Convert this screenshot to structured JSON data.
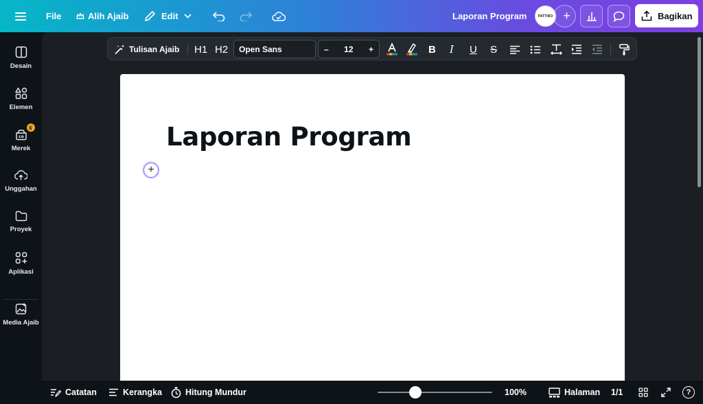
{
  "topbar": {
    "file_label": "File",
    "magic_switch_label": "Alih Ajaib",
    "edit_label": "Edit",
    "doc_title": "Laporan Program",
    "avatar_text": "PATTIRO",
    "share_label": "Bagikan"
  },
  "sidebar": {
    "items": [
      {
        "label": "Desain",
        "icon": "layout-icon"
      },
      {
        "label": "Elemen",
        "icon": "shapes-icon"
      },
      {
        "label": "Merek",
        "icon": "brand-icon"
      },
      {
        "label": "Unggahan",
        "icon": "cloud-upload-icon"
      },
      {
        "label": "Proyek",
        "icon": "folder-icon"
      },
      {
        "label": "Aplikasi",
        "icon": "apps-icon"
      },
      {
        "label": "Media Ajaib",
        "icon": "magic-media-icon"
      }
    ]
  },
  "format_toolbar": {
    "magic_write_label": "Tulisan Ajaib",
    "h1_label": "H1",
    "h2_label": "H2",
    "font_family": "Open Sans",
    "font_size": "12",
    "minus": "–",
    "plus": "+",
    "bold": "B",
    "italic": "I",
    "underline": "U",
    "strike": "S"
  },
  "page": {
    "heading": "Laporan Program"
  },
  "bottombar": {
    "notes_label": "Catatan",
    "outline_label": "Kerangka",
    "countdown_label": "Hitung Mundur",
    "zoom_value": "100%",
    "zoom_level": 0.33,
    "pages_label": "Halaman",
    "page_count": "1/1",
    "help": "?"
  },
  "colors": {
    "gradient_start": "#05b7c7",
    "gradient_end": "#7d3fe0",
    "dark_bg": "#0e1318",
    "canvas_bg": "#1b1f24"
  }
}
